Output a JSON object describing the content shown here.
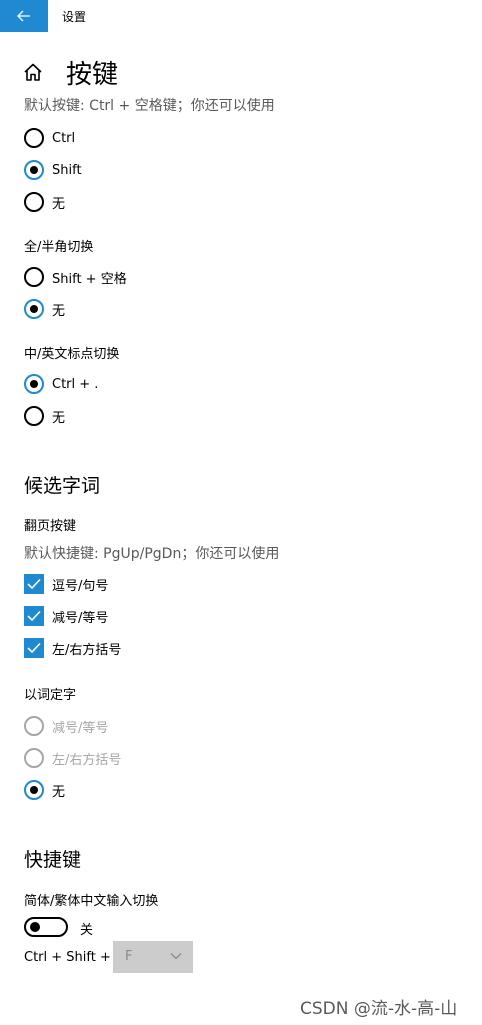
{
  "window": {
    "title": "设置"
  },
  "page": {
    "title": "按键",
    "description": "默认按键: Ctrl + 空格键；你还可以使用",
    "options": [
      {
        "label": "Ctrl",
        "checked": false
      },
      {
        "label": "Shift",
        "checked": true
      },
      {
        "label": "无",
        "checked": false
      }
    ]
  },
  "full_half_width": {
    "label": "全/半角切换",
    "options": [
      {
        "label": "Shift + 空格",
        "checked": false
      },
      {
        "label": "无",
        "checked": true
      }
    ]
  },
  "punctuation": {
    "label": "中/英文标点切换",
    "options": [
      {
        "label": "Ctrl + .",
        "checked": true
      },
      {
        "label": "无",
        "checked": false
      }
    ]
  },
  "candidates": {
    "title": "候选字词",
    "paging": {
      "label": "翻页按键",
      "description": "默认快捷键: PgUp/PgDn；你还可以使用",
      "options": [
        {
          "label": "逗号/句号",
          "checked": true
        },
        {
          "label": "减号/等号",
          "checked": true
        },
        {
          "label": "左/右方括号",
          "checked": true
        }
      ]
    },
    "word_select": {
      "label": "以词定字",
      "options": [
        {
          "label": "减号/等号",
          "checked": false,
          "disabled": true
        },
        {
          "label": "左/右方括号",
          "checked": false,
          "disabled": true
        },
        {
          "label": "无",
          "checked": true,
          "disabled": false
        }
      ]
    }
  },
  "shortcuts": {
    "title": "快捷键",
    "simplified_traditional": {
      "label": "简体/繁体中文输入切换",
      "toggle_state": "关",
      "toggle_on": false,
      "combo_label": "Ctrl + Shift +",
      "combo_value": "F"
    }
  },
  "watermark": "CSDN @流-水-高-山",
  "colors": {
    "accent": "#1f8ad2",
    "disabled": "#a6a6a6",
    "description": "#5a5a5a"
  }
}
